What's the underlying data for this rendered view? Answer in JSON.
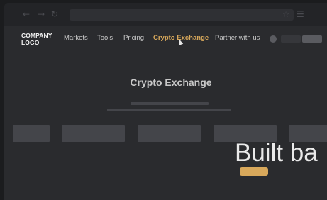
{
  "browser": {
    "back_icon": "←",
    "forward_icon": "→",
    "reload_icon": "↻",
    "star_icon": "☆",
    "menu_icon": "☰"
  },
  "header": {
    "logo": "COMPANY\nLOGO",
    "nav": [
      {
        "label": "Markets",
        "active": false
      },
      {
        "label": "Tools",
        "active": false
      },
      {
        "label": "Pricing",
        "active": false
      },
      {
        "label": "Crypto Exchange",
        "active": true
      },
      {
        "label": "Partner with us",
        "active": false
      }
    ]
  },
  "main": {
    "title": "Crypto Exchange",
    "hero_text": "Built ba"
  },
  "colors": {
    "accent": "#d8a85b",
    "background": "#2a2b2e",
    "placeholder": "#44454a"
  }
}
